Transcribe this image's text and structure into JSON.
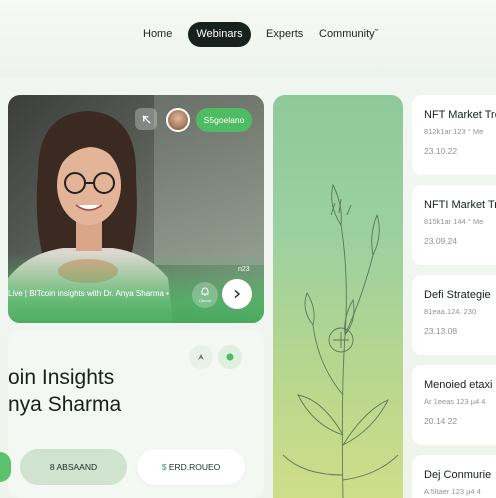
{
  "nav": {
    "items": [
      {
        "label": "Home"
      },
      {
        "label": "Webinars",
        "active": true
      },
      {
        "label": "Experts"
      },
      {
        "label": "Communityˇ"
      }
    ]
  },
  "video": {
    "session_label": "S5goelano",
    "time": "n23",
    "caption": "Live | BITcoin insights with Dr. Anya Sharma •",
    "mini_icon_label": "Decod"
  },
  "info": {
    "title_line1": "oin Insights",
    "title_line2": "nya Sharma",
    "secondary_button": "8 ABSAAND",
    "primary_button_symbol": "$",
    "primary_button": "ERD.ROUEO"
  },
  "list": [
    {
      "title": "NFT Market Tre",
      "sub": "812k1ar 123 ° Me",
      "date": "23.10.22"
    },
    {
      "title": "NFTI Market Tre",
      "sub": "815k1ar 144 ° Me",
      "date": "23.09.24"
    },
    {
      "title": "Defi Strategie",
      "sub": "81eaa.124. 230",
      "date": "23.13.08"
    },
    {
      "title": "Menoied etaxi",
      "sub": "Ar 1eeas 123 µ4 4",
      "date": "20.14 22"
    },
    {
      "title": "Dej Conmurie",
      "sub": "A 5ltaer 123 µ4 4",
      "date": ""
    }
  ],
  "colors": {
    "accent_green": "#4fbb62",
    "nav_active_bg": "#17211d",
    "panel_light": "#f4f8f3"
  }
}
